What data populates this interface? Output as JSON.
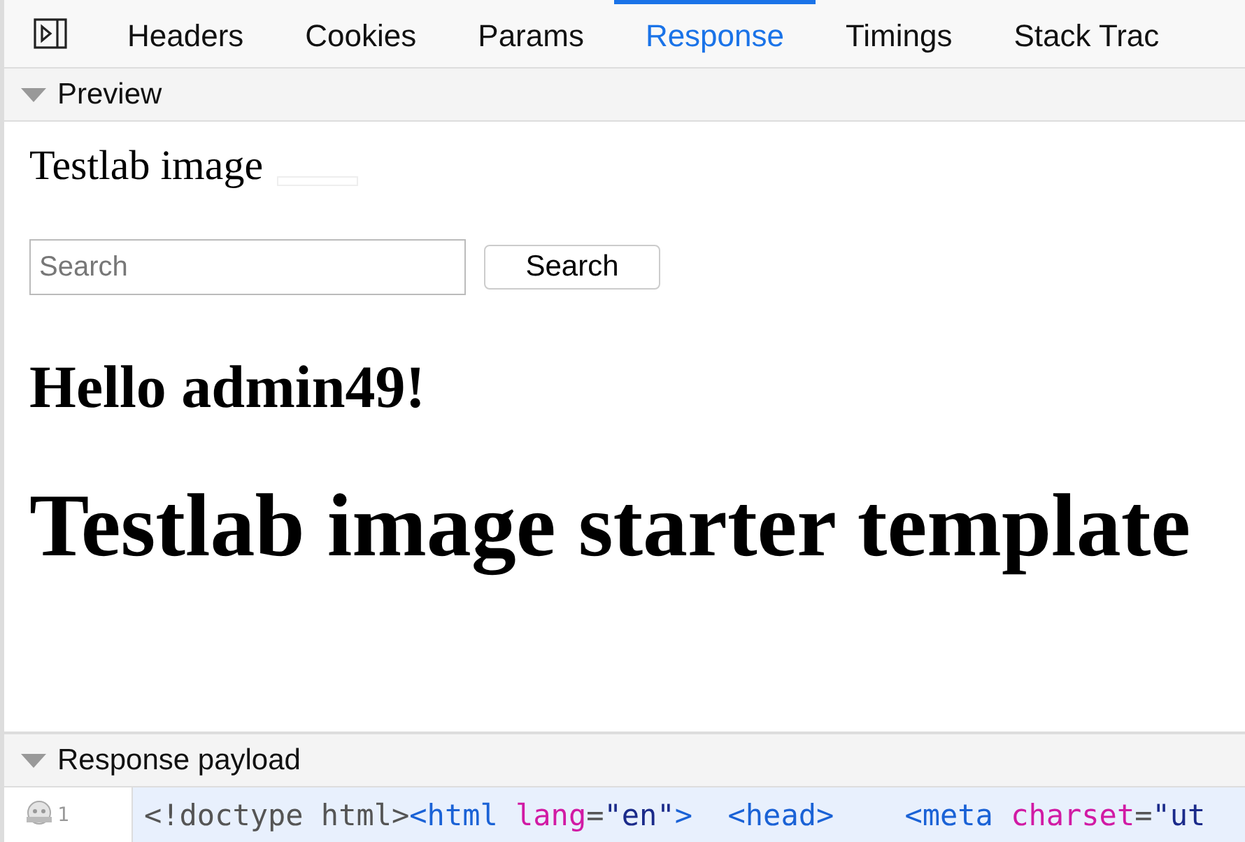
{
  "tabs": [
    {
      "label": "Headers",
      "selected": false
    },
    {
      "label": "Cookies",
      "selected": false
    },
    {
      "label": "Params",
      "selected": false
    },
    {
      "label": "Response",
      "selected": true
    },
    {
      "label": "Timings",
      "selected": false
    },
    {
      "label": "Stack Trac",
      "selected": false
    }
  ],
  "preview": {
    "title": "Preview",
    "expanded": true,
    "site_title": "Testlab image",
    "search": {
      "placeholder": "Search"
    },
    "search_button": "Search",
    "greeting": "Hello admin49!",
    "heading": "Testlab image starter template"
  },
  "payload": {
    "title": "Response payload",
    "expanded": true,
    "line_number": "1",
    "tokens": [
      {
        "kind": "doctype",
        "text": "<!doctype html>"
      },
      {
        "kind": "tag",
        "text": "<html"
      },
      {
        "kind": "attr",
        "text": " lang"
      },
      {
        "kind": "punct",
        "text": "="
      },
      {
        "kind": "value",
        "text": "\"en\""
      },
      {
        "kind": "tag",
        "text": ">"
      },
      {
        "kind": "tag",
        "text": "  <head>"
      },
      {
        "kind": "tag",
        "text": "    <meta"
      },
      {
        "kind": "attr",
        "text": " charset"
      },
      {
        "kind": "punct",
        "text": "="
      },
      {
        "kind": "value",
        "text": "\"ut"
      }
    ]
  }
}
